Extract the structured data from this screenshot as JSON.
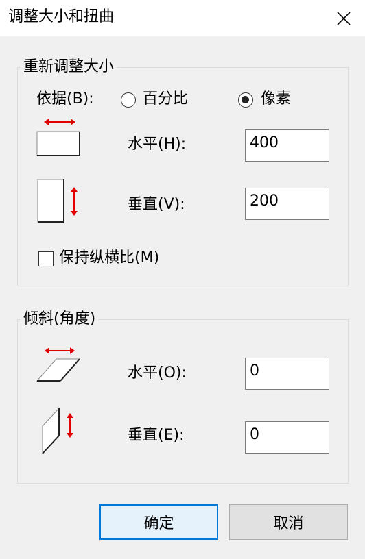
{
  "window": {
    "title": "调整大小和扭曲"
  },
  "resize": {
    "legend": "重新调整大小",
    "by_label": "依据(B):",
    "percent_label": "百分比",
    "pixels_label": "像素",
    "selected": "pixels",
    "horizontal_label": "水平(H):",
    "horizontal_value": "400",
    "vertical_label": "垂直(V):",
    "vertical_value": "200",
    "keep_ratio_label": "保持纵横比(M)",
    "keep_ratio_checked": false
  },
  "skew": {
    "legend": "倾斜(角度)",
    "horizontal_label": "水平(O):",
    "horizontal_value": "0",
    "vertical_label": "垂直(E):",
    "vertical_value": "0"
  },
  "buttons": {
    "ok": "确定",
    "cancel": "取消"
  },
  "colors": {
    "accent": "#0078d7",
    "arrow": "#e00000"
  }
}
